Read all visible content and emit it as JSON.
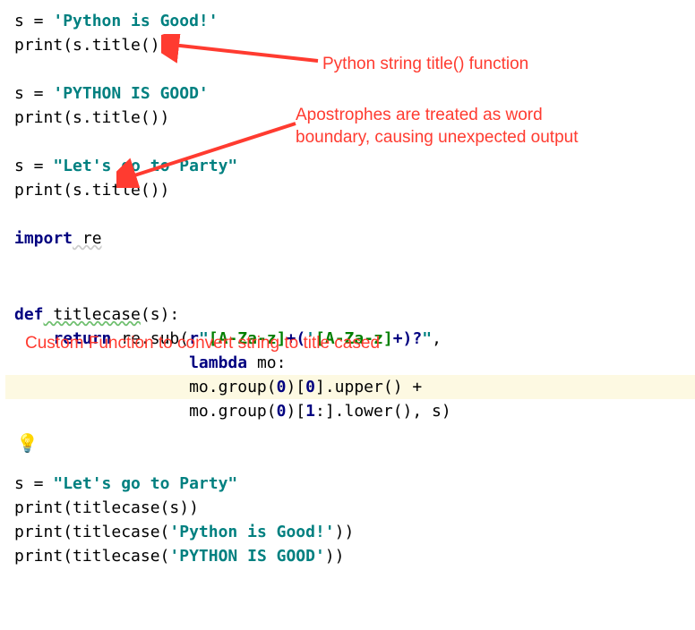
{
  "code": {
    "l1_assign": "s = ",
    "l1_str": "'Python is Good!'",
    "l2_print": "print",
    "l2_call": "(s.title())",
    "l3_assign": "s = ",
    "l3_str": "'PYTHON IS GOOD'",
    "l4_print": "print",
    "l4_call": "(s.title())",
    "l5_assign": "s = ",
    "l5_str": "\"Let's go to Party\"",
    "l6_print": "print",
    "l6_call": "(s.title())",
    "l7_import": "import",
    "l7_re": " re",
    "l8_def": "def",
    "l8_name": " titlecase",
    "l8_params": "(s):",
    "l9_return": "return",
    "l9_resub": " re.sub(",
    "l9_r": "r",
    "l9_q1": "\"",
    "l9_br1": "[A-Za-z]",
    "l9_plus1": "+(",
    "l9_apos": "'",
    "l9_br2": "[A-Za-z]",
    "l9_plus2": "+)?",
    "l9_q2": "\"",
    "l9_comma": ",",
    "l10_lambda": "lambda",
    "l10_mo": " mo:",
    "l11_expr": "mo.group(",
    "l11_zero": "0",
    "l11_rb": ")[",
    "l11_idx": "0",
    "l11_rb2": "].upper() +",
    "l12_expr": "mo.group(",
    "l12_zero": "0",
    "l12_rb": ")[",
    "l12_slice": "1",
    "l12_rb2": ":].lower(), s)",
    "l13_assign": "s = ",
    "l13_str": "\"Let's go to Party\"",
    "l14_print": "print",
    "l14_call": "(titlecase(s))",
    "l15_print": "print",
    "l15_call_a": "(titlecase(",
    "l15_str": "'Python is Good!'",
    "l15_call_b": "))",
    "l16_print": "print",
    "l16_call_a": "(titlecase(",
    "l16_str": "'PYTHON IS GOOD'",
    "l16_call_b": "))"
  },
  "annotations": {
    "title_func": "Python string title() function",
    "apostrophes_l1": "Apostrophes are treated as word",
    "apostrophes_l2": "boundary, causing unexpected output",
    "custom_func": "Custom Function to convert string to title cased"
  },
  "icons": {
    "lightbulb": "💡"
  }
}
